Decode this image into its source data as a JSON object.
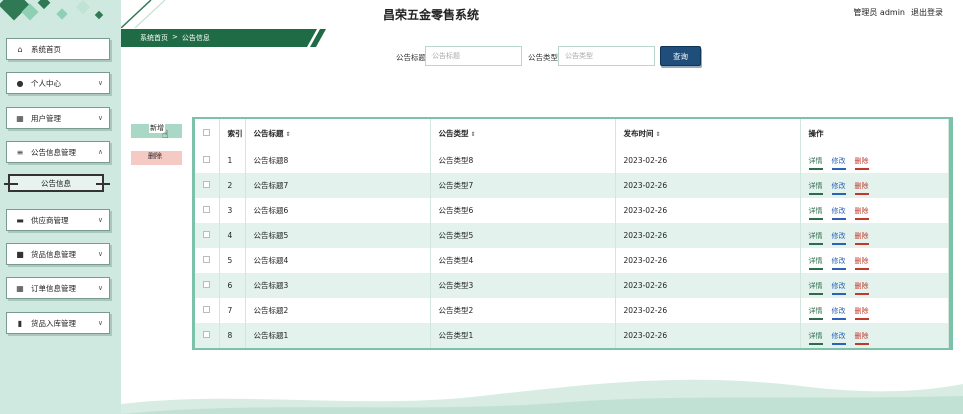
{
  "app": {
    "title": "昌荣五金零售系统"
  },
  "user": {
    "role_name": "管理员 admin",
    "logout": "退出登录"
  },
  "sidebar": {
    "items": [
      {
        "label": "系统首页",
        "icon": "home-icon"
      },
      {
        "label": "个人中心",
        "icon": "user-icon"
      },
      {
        "label": "用户管理",
        "icon": "grid-icon"
      },
      {
        "label": "公告信息管理",
        "icon": "list-icon"
      },
      {
        "label": "供应商管理",
        "icon": "briefcase-icon"
      },
      {
        "label": "货品信息管理",
        "icon": "box-icon"
      },
      {
        "label": "订单信息管理",
        "icon": "grid-icon"
      },
      {
        "label": "货品入库管理",
        "icon": "chart-icon"
      }
    ],
    "sub_item": "公告信息"
  },
  "breadcrumb": {
    "home": "系统首页",
    "sep": ">",
    "current": "公告信息"
  },
  "search": {
    "title_label": "公告标题",
    "title_placeholder": "公告标题",
    "type_label": "公告类型",
    "type_placeholder": "公告类型",
    "button": "查询"
  },
  "actions": {
    "add": "新增",
    "delete": "删除"
  },
  "table": {
    "headers": {
      "index": "索引",
      "title": "公告标题",
      "type": "公告类型",
      "time": "发布时间",
      "ops": "操作"
    },
    "ops": {
      "detail": "详情",
      "edit": "修改",
      "delete": "删除"
    },
    "rows": [
      {
        "index": "1",
        "title": "公告标题8",
        "type": "公告类型8",
        "time": "2023-02-26"
      },
      {
        "index": "2",
        "title": "公告标题7",
        "type": "公告类型7",
        "time": "2023-02-26"
      },
      {
        "index": "3",
        "title": "公告标题6",
        "type": "公告类型6",
        "time": "2023-02-26"
      },
      {
        "index": "4",
        "title": "公告标题5",
        "type": "公告类型5",
        "time": "2023-02-26"
      },
      {
        "index": "5",
        "title": "公告标题4",
        "type": "公告类型4",
        "time": "2023-02-26"
      },
      {
        "index": "6",
        "title": "公告标题3",
        "type": "公告类型3",
        "time": "2023-02-26"
      },
      {
        "index": "7",
        "title": "公告标题2",
        "type": "公告类型2",
        "time": "2023-02-26"
      },
      {
        "index": "8",
        "title": "公告标题1",
        "type": "公告类型1",
        "time": "2023-02-26"
      }
    ]
  },
  "colors": {
    "accent_green": "#1f6b45",
    "sidebar_bg": "#cfe9e0",
    "button_blue": "#1f4e7a"
  }
}
